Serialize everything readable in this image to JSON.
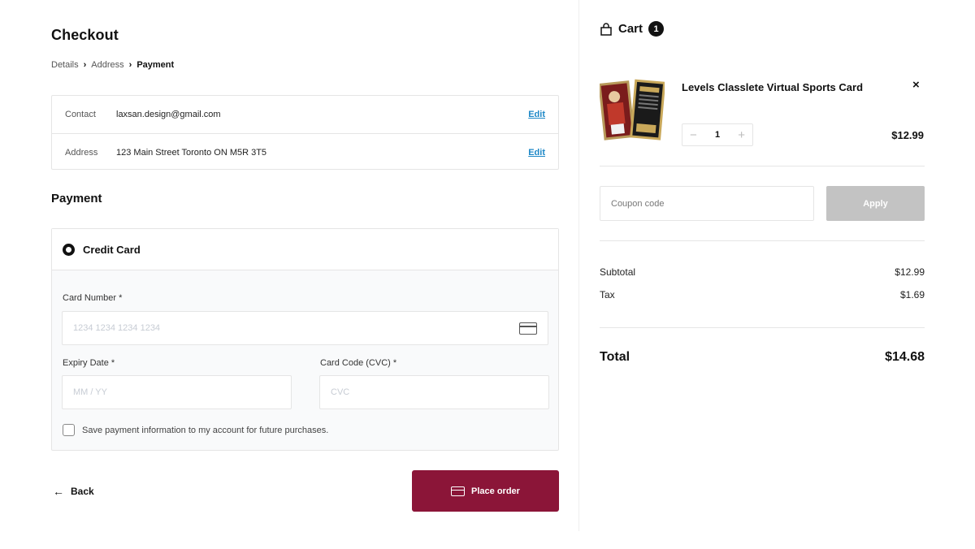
{
  "checkout": {
    "title": "Checkout",
    "breadcrumb": {
      "step1": "Details",
      "step2": "Address",
      "step3": "Payment"
    },
    "contact": {
      "label": "Contact",
      "value": "laxsan.design@gmail.com",
      "edit": "Edit"
    },
    "address": {
      "label": "Address",
      "value": "123 Main Street Toronto ON M5R 3T5",
      "edit": "Edit"
    },
    "payment_title": "Payment",
    "method": "Credit Card",
    "card_number": {
      "label": "Card Number *",
      "placeholder": "1234 1234 1234 1234"
    },
    "expiry": {
      "label": "Expiry Date *",
      "placeholder": "MM / YY"
    },
    "cvc": {
      "label": "Card Code (CVC) *",
      "placeholder": "CVC"
    },
    "save_info": "Save payment information to my account for future purchases.",
    "back": "Back",
    "place_order": "Place order",
    "accent_color": "#8b1538"
  },
  "cart": {
    "title": "Cart",
    "count": "1",
    "item": {
      "name": "Levels Classlete Virtual Sports Card",
      "quantity": "1",
      "price": "$12.99"
    },
    "coupon_placeholder": "Coupon code",
    "apply": "Apply",
    "subtotal_label": "Subtotal",
    "subtotal": "$12.99",
    "tax_label": "Tax",
    "tax": "$1.69",
    "total_label": "Total",
    "total": "$14.68"
  }
}
